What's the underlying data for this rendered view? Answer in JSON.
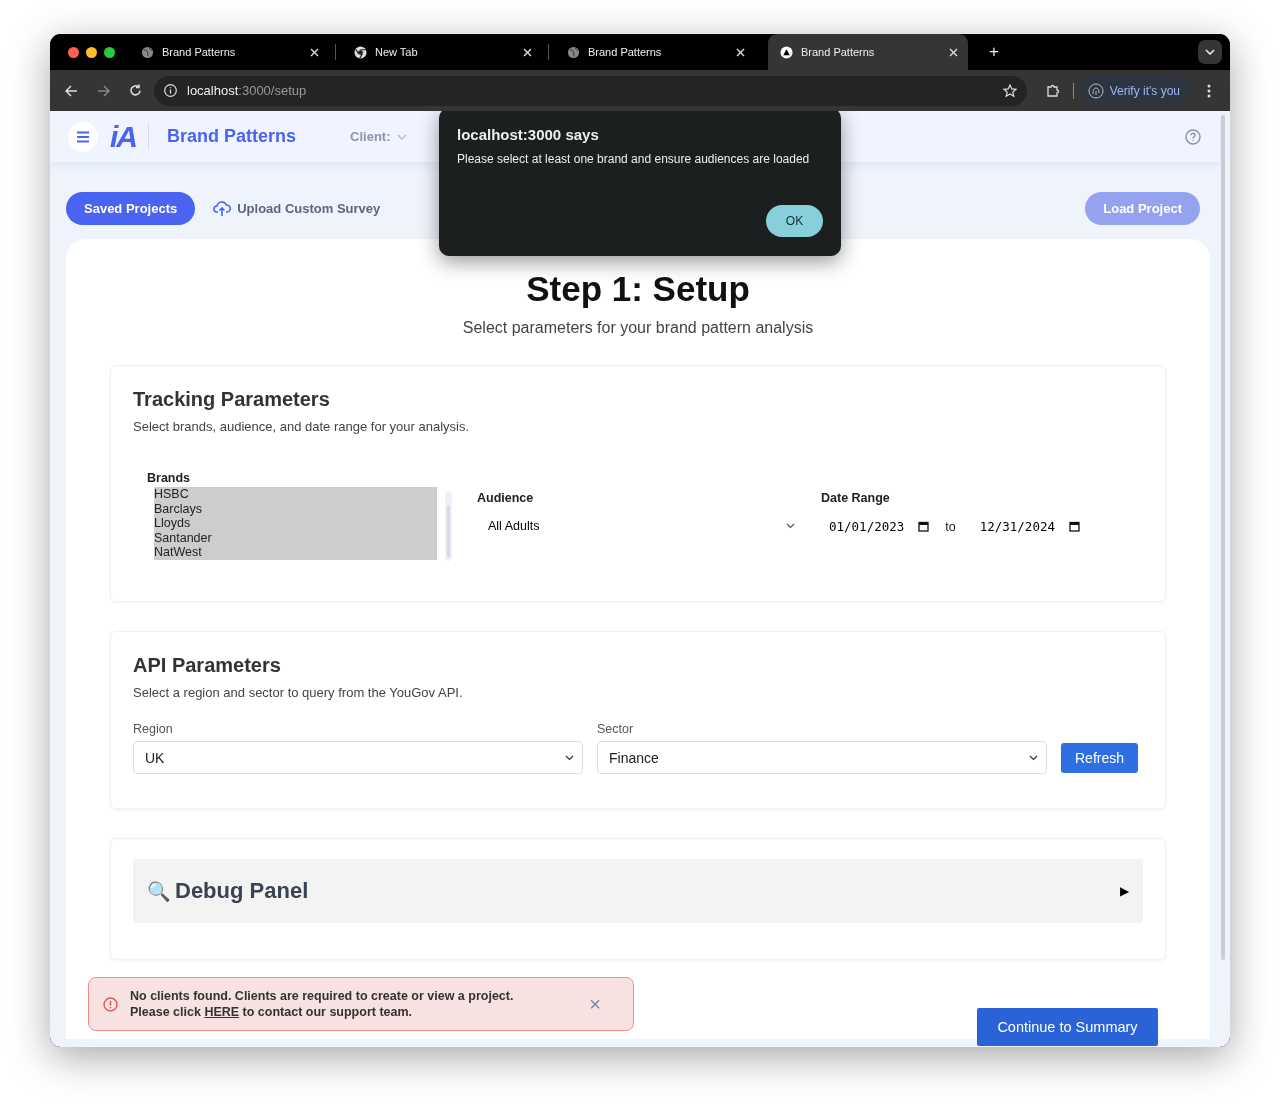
{
  "browser": {
    "tabs": [
      {
        "title": "Brand Patterns",
        "kind": "globe",
        "selected": false
      },
      {
        "title": "New Tab",
        "kind": "chrome",
        "selected": false
      },
      {
        "title": "Brand Patterns",
        "kind": "globe",
        "selected": false
      },
      {
        "title": "Brand Patterns",
        "kind": "triangle",
        "selected": true
      }
    ],
    "new_tab": "+",
    "address": {
      "host": "localhost",
      "path": ":3000/setup"
    },
    "profile_button": "Verify it's you"
  },
  "app": {
    "logo": "iA",
    "title": "Brand Patterns",
    "client_label": "Client:"
  },
  "toolbar": {
    "saved_projects": "Saved Projects",
    "upload": "Upload Custom Survey",
    "load_project": {
      "label": "Load Project",
      "disabled": true
    }
  },
  "page": {
    "title": "Step 1: Setup",
    "subtitle": "Select parameters for your brand pattern analysis"
  },
  "tracking": {
    "title": "Tracking Parameters",
    "description": "Select brands, audience, and date range for your analysis.",
    "brands": {
      "label": "Brands",
      "options": [
        {
          "label": "HSBC",
          "selected": true
        },
        {
          "label": "Barclays",
          "selected": true
        },
        {
          "label": "Lloyds",
          "selected": true
        },
        {
          "label": "Santander",
          "selected": true
        },
        {
          "label": "NatWest",
          "selected": true
        }
      ]
    },
    "audience": {
      "label": "Audience",
      "value": "All Adults"
    },
    "date_range": {
      "label": "Date Range",
      "start": "01/01/2023",
      "separator": "to",
      "end": "12/31/2024"
    }
  },
  "api": {
    "title": "API Parameters",
    "description": "Select a region and sector to query from the YouGov API.",
    "region": {
      "label": "Region",
      "value": "UK"
    },
    "sector": {
      "label": "Sector",
      "value": "Finance"
    },
    "refresh": "Refresh"
  },
  "debug": {
    "icon": "🔍",
    "title": "Debug Panel",
    "toggle": "▶",
    "expanded": false
  },
  "alert": {
    "text": "No clients found. Clients are required to create or view a project.",
    "before_link": "Please click",
    "link": "HERE",
    "after_link": "to contact our support team.",
    "close": "×"
  },
  "continue_button": "Continue to Summary",
  "dialog": {
    "title": "localhost:3000 says",
    "message": "Please select at least one brand and ensure audiences are loaded",
    "ok": "OK"
  }
}
